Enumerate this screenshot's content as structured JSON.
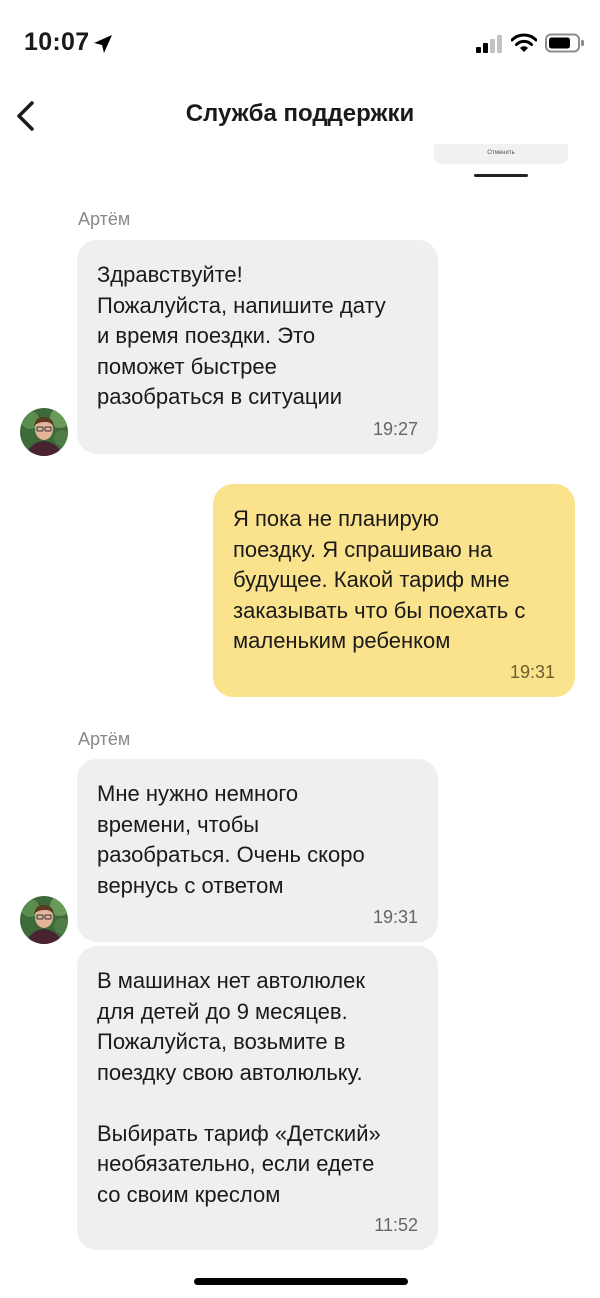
{
  "status_bar": {
    "time": "10:07"
  },
  "header": {
    "title": "Служба поддержки"
  },
  "previous_attachment": {
    "caption": "Отменить"
  },
  "colors": {
    "incoming_bubble": "#efefef",
    "outgoing_bubble": "#fbe38e",
    "sender_name": "#8a8a8a"
  },
  "messages": [
    {
      "sender": "Артём",
      "direction": "incoming",
      "text": "Здравствуйте!\nПожалуйста, напишите дату\nи время поездки. Это\nпоможет быстрее\nразобраться в ситуации",
      "time": "19:27"
    },
    {
      "sender": "",
      "direction": "outgoing",
      "text": "Я пока не планирую\nпоездку. Я спрашиваю на\nбудущее. Какой тариф мне\nзаказывать что бы поехать с\nмаленьким ребенком",
      "time": "19:31"
    },
    {
      "sender": "Артём",
      "direction": "incoming",
      "text": "Мне нужно немного\nвремени, чтобы\nразобраться. Очень скоро\nвернусь с ответом",
      "time": "19:31"
    },
    {
      "sender": "",
      "direction": "incoming",
      "text": "В машинах нет автолюлек\nдля детей до 9 месяцев.\nПожалуйста, возьмите в\nпоездку свою автолюльку.\n\nВыбирать тариф «Детский»\nнеобязательно, если едете\nсо своим креслом",
      "time": "11:52"
    }
  ]
}
